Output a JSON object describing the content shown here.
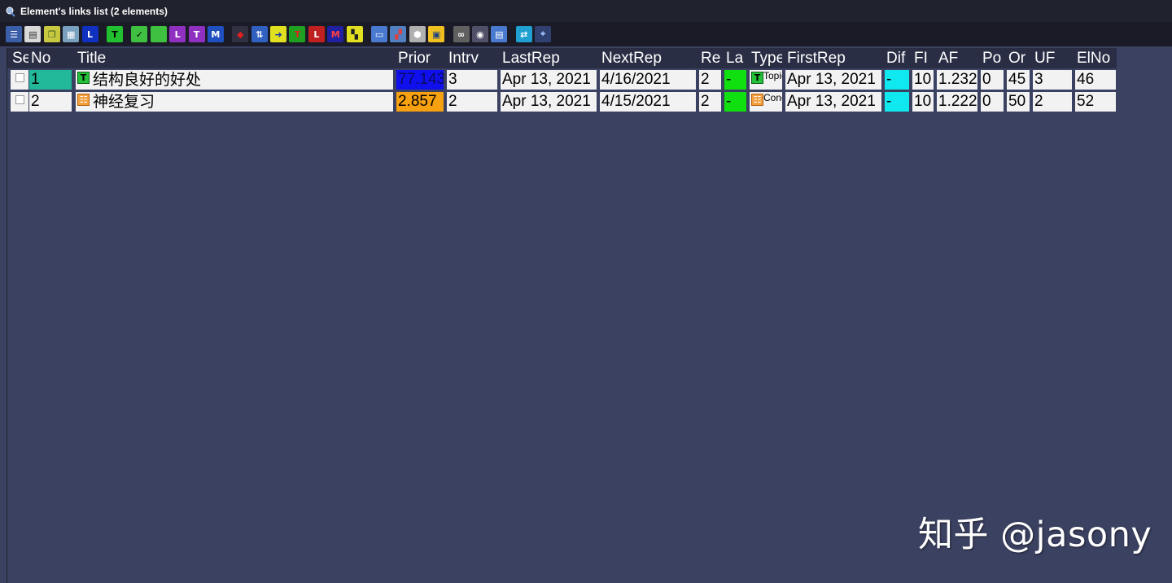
{
  "window": {
    "title": "Element's links list (2 elements)"
  },
  "toolbar": {
    "buttons": [
      {
        "icon": "menu-icon",
        "glyph": "☰",
        "bg": "#3a5ea8",
        "fg": "#ffffff"
      },
      {
        "icon": "list-icon",
        "glyph": "▤",
        "bg": "#d8d8d8",
        "fg": "#333333"
      },
      {
        "icon": "copy-icon",
        "glyph": "❐",
        "bg": "#c8c840",
        "fg": "#335522"
      },
      {
        "icon": "grid-icon",
        "glyph": "▦",
        "bg": "#7aa0c0",
        "fg": "#ffffff"
      },
      {
        "icon": "l-icon",
        "glyph": "L",
        "bg": "#1030c0",
        "fg": "#ffffff"
      },
      {
        "sep": true
      },
      {
        "icon": "topic-t-icon",
        "glyph": "T",
        "bg": "#22c030",
        "fg": "#000000"
      },
      {
        "sep": true
      },
      {
        "icon": "check-green-icon",
        "glyph": "✓",
        "bg": "#40c040",
        "fg": "#000000"
      },
      {
        "icon": "green-square-icon",
        "glyph": "",
        "bg": "#40c040",
        "fg": "#000000"
      },
      {
        "icon": "l-purple-icon",
        "glyph": "L",
        "bg": "#9030c0",
        "fg": "#ffffff"
      },
      {
        "icon": "t-purple-icon",
        "glyph": "T",
        "bg": "#9030c0",
        "fg": "#ffffff"
      },
      {
        "icon": "m-blue-icon",
        "glyph": "M",
        "bg": "#2050c0",
        "fg": "#ffffff"
      },
      {
        "sep": true
      },
      {
        "icon": "eraser-icon",
        "glyph": "◆",
        "bg": "#303040",
        "fg": "#e02020"
      },
      {
        "icon": "sort-icon",
        "glyph": "⇅",
        "bg": "#3060c0",
        "fg": "#ffffff"
      },
      {
        "icon": "arrow-yellow-icon",
        "glyph": "➜",
        "bg": "#e0e020",
        "fg": "#1030a0"
      },
      {
        "icon": "t-red-icon",
        "glyph": "T",
        "bg": "#20a020",
        "fg": "#e02020"
      },
      {
        "icon": "l-red-icon",
        "glyph": "L",
        "bg": "#c02020",
        "fg": "#ffffff"
      },
      {
        "icon": "m-red-icon",
        "glyph": "M",
        "bg": "#2020a0",
        "fg": "#ff4040"
      },
      {
        "icon": "tree-icon",
        "glyph": "▚",
        "bg": "#e0e020",
        "fg": "#202020"
      },
      {
        "sep": true
      },
      {
        "icon": "browser-icon",
        "glyph": "▭",
        "bg": "#4a7ad0",
        "fg": "#ffffff"
      },
      {
        "icon": "image-icon",
        "glyph": "▞",
        "bg": "#5080c0",
        "fg": "#e04040"
      },
      {
        "icon": "cube-icon",
        "glyph": "⬢",
        "bg": "#b0b0b0",
        "fg": "#ffffff"
      },
      {
        "icon": "calendar-icon",
        "glyph": "▣",
        "bg": "#f0c020",
        "fg": "#204080"
      },
      {
        "sep": true
      },
      {
        "icon": "binoculars-icon",
        "glyph": "∞",
        "bg": "#606060",
        "fg": "#ffffff"
      },
      {
        "icon": "eye-icon",
        "glyph": "◉",
        "bg": "#505068",
        "fg": "#ffffff"
      },
      {
        "icon": "save-icon",
        "glyph": "▤",
        "bg": "#4a7ad0",
        "fg": "#ffffff"
      },
      {
        "sep": true
      },
      {
        "icon": "swap-icon",
        "glyph": "⇄",
        "bg": "#20a0d0",
        "fg": "#ffffff"
      },
      {
        "icon": "pin-icon",
        "glyph": "⌖",
        "bg": "#304070",
        "fg": "#a0c0ff"
      }
    ]
  },
  "table": {
    "columns": [
      {
        "key": "sel",
        "label": "Sel"
      },
      {
        "key": "no",
        "label": "No"
      },
      {
        "key": "title",
        "label": "Title"
      },
      {
        "key": "prior",
        "label": "Prior"
      },
      {
        "key": "intrv",
        "label": "Intrv"
      },
      {
        "key": "lastrep",
        "label": "LastRep"
      },
      {
        "key": "nextrep",
        "label": "NextRep"
      },
      {
        "key": "re",
        "label": "Re"
      },
      {
        "key": "la",
        "label": "La"
      },
      {
        "key": "type",
        "label": "Type"
      },
      {
        "key": "firstrep",
        "label": "FirstRep"
      },
      {
        "key": "dif",
        "label": "Dif"
      },
      {
        "key": "fl",
        "label": "FI"
      },
      {
        "key": "af",
        "label": "AF"
      },
      {
        "key": "po",
        "label": "Po"
      },
      {
        "key": "or",
        "label": "Or"
      },
      {
        "key": "uf",
        "label": "UF"
      },
      {
        "key": "elno",
        "label": "ElNo"
      }
    ],
    "rows": [
      {
        "no": "1",
        "title": "结构良好的好处",
        "type_icon": "topic",
        "prior": "77.143",
        "intrv": "3",
        "lastrep": "Apr 13, 2021",
        "nextrep": "4/16/2021",
        "re": "2",
        "la": "-",
        "type": "Topic",
        "firstrep": "Apr 13, 2021",
        "dif": "-",
        "fl": "10",
        "af": "1.232",
        "po": "0",
        "or": "45",
        "uf": "3",
        "elno": "46",
        "no_bg": "#22b89a",
        "prior_bg": "#1010ee",
        "prior_fg": "#0a0a60"
      },
      {
        "no": "2",
        "title": "神经复习",
        "type_icon": "concept",
        "prior": "2.857",
        "intrv": "2",
        "lastrep": "Apr 13, 2021",
        "nextrep": "4/15/2021",
        "re": "2",
        "la": "-",
        "type": "Concept",
        "firstrep": "Apr 13, 2021",
        "dif": "-",
        "fl": "10",
        "af": "1.222",
        "po": "0",
        "or": "50",
        "uf": "2",
        "elno": "52",
        "no_bg": "#f2f2f2",
        "prior_bg": "#f7a010",
        "prior_fg": "#000000"
      }
    ],
    "colors": {
      "la_bg": "#10e010",
      "dif_bg": "#10e8f0"
    }
  },
  "watermark": {
    "text": "知乎 @jasony"
  }
}
